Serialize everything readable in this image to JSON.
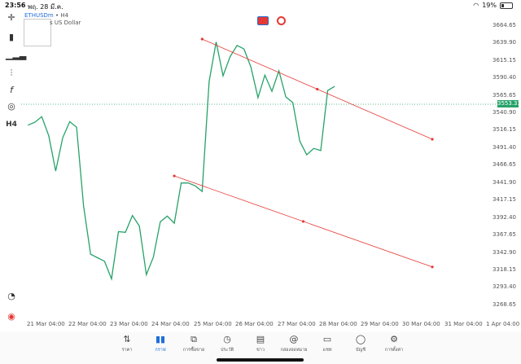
{
  "status_bar": {
    "time": "23:56",
    "date": "พฤ. 28 มี.ค.",
    "battery": "19%"
  },
  "symbol": {
    "name": "ETHUSDm",
    "timeframe": "H4",
    "description": "s US Dollar"
  },
  "sidebar": {
    "timeframe_label": "H4"
  },
  "price_axis": {
    "labels": [
      "3664.65",
      "3639.90",
      "3615.15",
      "3590.40",
      "3565.65",
      "3540.90",
      "3516.15",
      "3491.40",
      "3466.65",
      "3441.90",
      "3417.15",
      "3392.40",
      "3367.65",
      "3342.90",
      "3318.15",
      "3293.40",
      "3268.65"
    ],
    "current_price": "3553.31"
  },
  "time_axis": {
    "labels": [
      "21 Mar 04:00",
      "22 Mar 04:00",
      "23 Mar 04:00",
      "24 Mar 04:00",
      "25 Mar 04:00",
      "26 Mar 04:00",
      "27 Mar 04:00",
      "28 Mar 04:00",
      "29 Mar 04:00",
      "30 Mar 04:00",
      "31 Mar 04:00",
      "1 Apr 04:00"
    ]
  },
  "chart_data": {
    "type": "line",
    "symbol": "ETHUSDm",
    "timeframe": "H4",
    "line_color": "#26a269",
    "trendline_color": "#e53935",
    "current_price": 3553.31,
    "x": [
      "20 Mar 20:00",
      "21 Mar 00:00",
      "21 Mar 04:00",
      "21 Mar 08:00",
      "21 Mar 12:00",
      "21 Mar 16:00",
      "21 Mar 20:00",
      "22 Mar 00:00",
      "22 Mar 04:00",
      "22 Mar 08:00",
      "22 Mar 12:00",
      "22 Mar 16:00",
      "22 Mar 20:00",
      "23 Mar 00:00",
      "23 Mar 04:00",
      "23 Mar 08:00",
      "23 Mar 12:00",
      "23 Mar 16:00",
      "23 Mar 20:00",
      "24 Mar 00:00",
      "24 Mar 04:00",
      "24 Mar 08:00",
      "24 Mar 12:00",
      "24 Mar 16:00",
      "24 Mar 20:00",
      "25 Mar 00:00",
      "25 Mar 04:00",
      "25 Mar 08:00",
      "25 Mar 12:00",
      "25 Mar 16:00",
      "25 Mar 20:00",
      "26 Mar 00:00",
      "26 Mar 04:00",
      "26 Mar 08:00",
      "26 Mar 12:00",
      "26 Mar 16:00",
      "26 Mar 20:00",
      "27 Mar 00:00",
      "27 Mar 04:00",
      "27 Mar 08:00",
      "27 Mar 12:00",
      "27 Mar 16:00",
      "27 Mar 20:00",
      "28 Mar 00:00",
      "28 Mar 04:00"
    ],
    "values": [
      3523,
      3527,
      3535,
      3508,
      3458,
      3505,
      3528,
      3520,
      3408,
      3340,
      3335,
      3330,
      3305,
      3372,
      3371,
      3395,
      3380,
      3311,
      3336,
      3386,
      3394,
      3384,
      3441,
      3441,
      3437,
      3429,
      3585,
      3641,
      3593,
      3620,
      3636,
      3631,
      3605,
      3562,
      3594,
      3571,
      3600,
      3563,
      3555,
      3500,
      3481,
      3490,
      3487,
      3572,
      3578,
      3578,
      3553
    ],
    "trendlines": [
      {
        "start": {
          "time": "25 Mar 00:00",
          "price": 3645
        },
        "end": {
          "time": "30 Mar 12:00",
          "price": 3503
        }
      },
      {
        "start": {
          "time": "24 Mar 08:00",
          "price": 3451
        },
        "end": {
          "time": "30 Mar 12:00",
          "price": 3322
        }
      }
    ],
    "ylim": [
      3268.65,
      3664.65
    ]
  },
  "bottom_nav": {
    "items": [
      {
        "label": "ราคา",
        "icon": "quotes-icon"
      },
      {
        "label": "กราฟ",
        "icon": "chart-icon"
      },
      {
        "label": "การซื้อขาย",
        "icon": "trade-icon"
      },
      {
        "label": "ประวัติ",
        "icon": "history-icon"
      },
      {
        "label": "ข่าว",
        "icon": "news-icon"
      },
      {
        "label": "กล่องจดหมาย",
        "icon": "mailbox-icon"
      },
      {
        "label": "แชท",
        "icon": "chat-icon"
      },
      {
        "label": "บัญชี",
        "icon": "account-icon"
      },
      {
        "label": "การตั้งค่า",
        "icon": "settings-icon"
      }
    ],
    "active_index": 1
  }
}
